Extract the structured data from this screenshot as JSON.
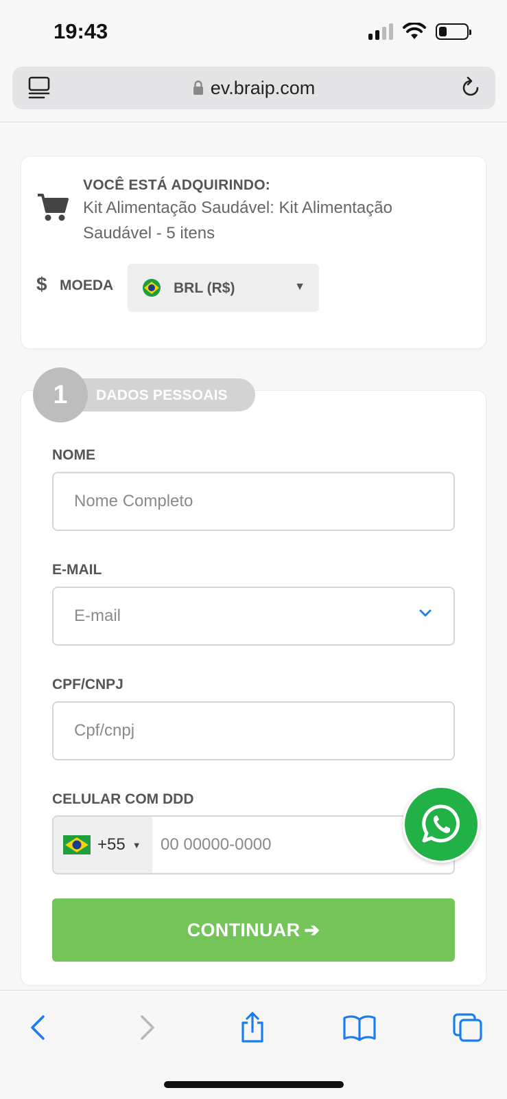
{
  "status_bar": {
    "time": "19:43"
  },
  "browser": {
    "url": "ev.braip.com"
  },
  "product": {
    "heading": "VOCÊ ESTÁ ADQUIRINDO:",
    "name": "Kit Alimentação Saudável: Kit Alimentação Saudável - 5 itens",
    "currency_symbol": "$",
    "currency_label": "MOEDA",
    "currency_value": "BRL (R$)",
    "currency_caret": "▼"
  },
  "step": {
    "number": "1",
    "title": "DADOS PESSOAIS"
  },
  "form": {
    "name_label": "NOME",
    "name_placeholder": "Nome Completo",
    "email_label": "E-MAIL",
    "email_placeholder": "E-mail",
    "cpf_label": "CPF/CNPJ",
    "cpf_placeholder": "Cpf/cnpj",
    "phone_label": "CELULAR COM DDD",
    "phone_ddi": "+55",
    "phone_caret": "▼",
    "phone_placeholder": "00 00000-0000",
    "continue_label": "CONTINUAR",
    "continue_arrow": "➔"
  },
  "colors": {
    "accent_green": "#74c45a",
    "whatsapp_green": "#22b147",
    "ios_blue": "#1a7ef0"
  },
  "icons": [
    "reader-icon",
    "lock-icon",
    "reload-icon",
    "cart-icon",
    "brazil-flag-icon",
    "chevron-down-icon",
    "whatsapp-icon",
    "back-icon",
    "forward-icon",
    "share-icon",
    "bookmarks-icon",
    "tabs-icon"
  ]
}
